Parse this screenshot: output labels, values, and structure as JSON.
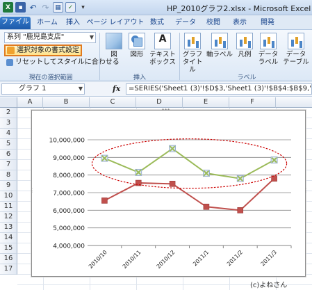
{
  "window": {
    "title": "HP_2010グラフ2.xlsx - Microsoft Excel"
  },
  "tabs": [
    "ファイル",
    "ホーム",
    "挿入",
    "ページ レイアウト",
    "数式",
    "データ",
    "校閲",
    "表示",
    "開発"
  ],
  "ribbon": {
    "selection_combo": "系列 \"鹿児島支店\"",
    "format_selection_button": "選択対象の書式設定",
    "reset_button": "リセットしてスタイルに合わせる",
    "group_current_selection": "現在の選択範囲",
    "insert": {
      "group_label": "挿入",
      "picture": "図",
      "shapes": "図形",
      "textbox_line1": "テキスト",
      "textbox_line2": "ボックス"
    },
    "labels": {
      "group_label": "ラベル",
      "chart_title_1": "グラフ",
      "chart_title_2": "タイトル",
      "axis_titles": "軸ラベル",
      "legend": "凡例",
      "data_labels_1": "データ",
      "data_labels_2": "ラベル",
      "data_table_1": "データ",
      "data_table_2": "テーブル"
    }
  },
  "formula_bar": {
    "name_box": "グラフ 1",
    "fx": "fx",
    "formula": "=SERIES('Sheet1 (3)'!$D$3,'Sheet1 (3)'!$B$4:$B$9,'"
  },
  "grid": {
    "columns": [
      "A",
      "B",
      "C",
      "D",
      "E",
      "F"
    ],
    "rows": [
      "2",
      "3",
      "4",
      "5",
      "6",
      "7",
      "8",
      "9",
      "10",
      "11",
      "12",
      "13",
      "14",
      "15",
      "16",
      "17"
    ]
  },
  "chart_data": {
    "type": "line",
    "categories": [
      "2010/10",
      "2010/11",
      "2010/12",
      "2011/1",
      "2011/2",
      "2011/3"
    ],
    "series": [
      {
        "values": [
          8950000,
          8150000,
          9500000,
          8100000,
          7800000,
          8850000
        ],
        "color": "#9bbb59",
        "marker": "x"
      },
      {
        "values": [
          6550000,
          7550000,
          7500000,
          6200000,
          6000000,
          7800000
        ],
        "color": "#c0504d",
        "marker": "square"
      }
    ],
    "ylim": [
      4000000,
      10000000
    ],
    "y_ticks": [
      "4,000,000",
      "5,000,000",
      "6,000,000",
      "7,000,000",
      "8,000,000",
      "9,000,000",
      "10,000,000"
    ],
    "gridlines": true,
    "annotation": "dashed red ellipse around upper series",
    "annotation_color": "#cc0000"
  },
  "credit": "(c)よねさん"
}
